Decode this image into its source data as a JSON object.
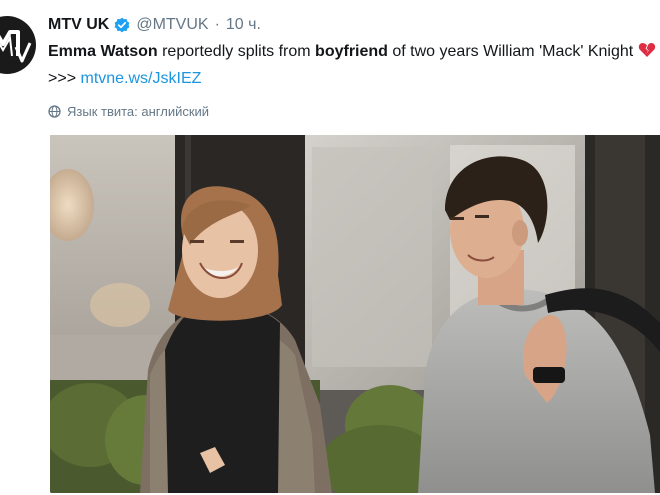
{
  "tweet": {
    "display_name": "MTV UK",
    "handle": "@MTVUK",
    "separator": "·",
    "time": "10 ч.",
    "text_parts": {
      "name": "Emma Watson",
      "mid1": " reportedly splits from ",
      "bold2": "boyfriend",
      "mid2": " of two years William 'Mack' Knight ",
      "arrows": " >>> ",
      "link": "mtvne.ws/JskIEZ"
    },
    "language_note": "Язык твита: английский"
  },
  "icons": {
    "avatar": "mtv-logo-icon",
    "verified": "verified-badge-icon",
    "broken_heart": "broken-heart-emoji",
    "globe": "globe-icon"
  },
  "colors": {
    "link": "#1b95e0",
    "verified": "#1da1f2",
    "muted": "#657786",
    "text": "#14171a"
  }
}
